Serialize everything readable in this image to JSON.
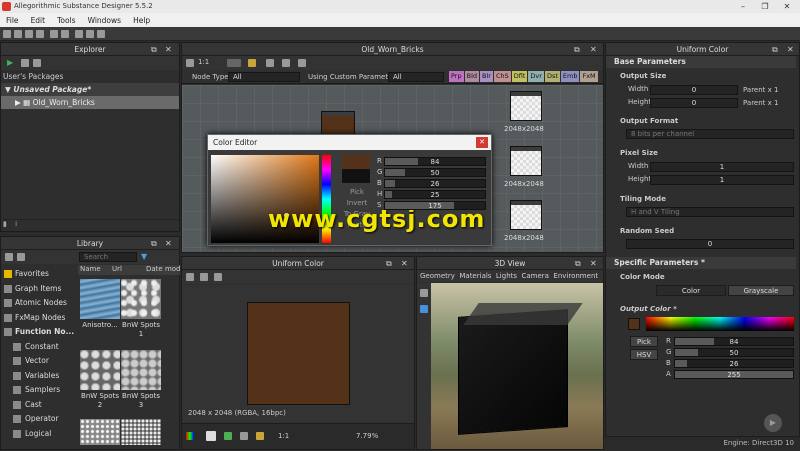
{
  "window": {
    "title": "Allegorithmic Substance Designer 5.5.2",
    "minimize": "–",
    "maximize": "❐",
    "close": "✕"
  },
  "menu": [
    "File",
    "Edit",
    "Tools",
    "Windows",
    "Help"
  ],
  "explorer": {
    "title": "Explorer",
    "root": "User's Packages",
    "package": "Unsaved Package*",
    "graph": "Old_Worn_Bricks"
  },
  "graph_panel": {
    "title": "Old_Worn_Bricks",
    "zoom": "1:1",
    "node_type_label": "Node Type",
    "node_type_value": "All",
    "custom_params_label": "Using Custom Parameters",
    "custom_params_value": "All",
    "tags": [
      {
        "label": "Prp",
        "color": "#c070c0"
      },
      {
        "label": "Bld",
        "color": "#b08aa0"
      },
      {
        "label": "Blr",
        "color": "#a890c0"
      },
      {
        "label": "ChS",
        "color": "#c09090"
      },
      {
        "label": "Dflt",
        "color": "#c0c060"
      },
      {
        "label": "Dvr",
        "color": "#90b0b0"
      },
      {
        "label": "Dst",
        "color": "#b0b070"
      },
      {
        "label": "Emb",
        "color": "#9090c0"
      },
      {
        "label": "FxM",
        "color": "#b0a090"
      }
    ],
    "node_labels": [
      "2048x2048",
      "2048x2048",
      "2048x2048"
    ]
  },
  "color_editor": {
    "title": "Color Editor",
    "close": "✕",
    "actions": [
      "Pick",
      "Invert",
      "To Gray",
      "Paste"
    ],
    "channels": [
      {
        "key": "R",
        "value": 84,
        "max": 255
      },
      {
        "key": "G",
        "value": 50,
        "max": 255
      },
      {
        "key": "B",
        "value": 26,
        "max": 255
      },
      {
        "key": "H",
        "value": 25,
        "max": 360
      },
      {
        "key": "S",
        "value": 175,
        "max": 255
      }
    ],
    "swatch": "#54321a"
  },
  "library": {
    "title": "Library",
    "search_placeholder": "Search",
    "columns": [
      "Name",
      "Url",
      "Date modi"
    ],
    "categories": [
      "Favorites",
      "Graph Items",
      "Atomic Nodes",
      "FxMap Nodes",
      "Function No...",
      "Constant",
      "Vector",
      "Variables",
      "Samplers",
      "Cast",
      "Operator",
      "Logical"
    ],
    "thumbs": [
      "Anisotro...",
      "BnW Spots 1",
      "BnW Spots 2",
      "BnW Spots 3"
    ]
  },
  "view2d": {
    "title": "Uniform Color",
    "info": "2048 x 2048 (RGBA, 16bpc)",
    "zoom": "7.79%",
    "ratio": "1:1",
    "color": "#54321a"
  },
  "view3d": {
    "title": "3D View",
    "menu": [
      "Geometry",
      "Materials",
      "Lights",
      "Camera",
      "Environment"
    ]
  },
  "params": {
    "title": "Uniform Color",
    "base_section": "Base Parameters",
    "output_size": "Output Size",
    "width_label": "Width",
    "width_value": "0",
    "width_mode": "Parent x 1",
    "height_label": "Height",
    "height_value": "0",
    "height_mode": "Parent x 1",
    "output_format": "Output Format",
    "output_format_value": "8 bits per channel",
    "pixel_size": "Pixel Size",
    "px_width_label": "Width",
    "px_width_value": "1",
    "px_height_label": "Height",
    "px_height_value": "1",
    "tiling_mode": "Tiling Mode",
    "tiling_value": "H and V Tiling",
    "random_seed": "Random Seed",
    "random_value": "0",
    "specific_section": "Specific Parameters *",
    "color_mode": "Color Mode",
    "mode_color": "Color",
    "mode_gray": "Grayscale",
    "output_color": "Output Color *",
    "pick": "Pick",
    "hsv": "HSV",
    "channels": [
      {
        "key": "R",
        "value": 84
      },
      {
        "key": "G",
        "value": 50
      },
      {
        "key": "B",
        "value": 26
      },
      {
        "key": "A",
        "value": 255
      }
    ],
    "swatch": "#54321a"
  },
  "status": {
    "engine": "Engine: Direct3D 10"
  },
  "watermark": "www.cgtsj.com"
}
